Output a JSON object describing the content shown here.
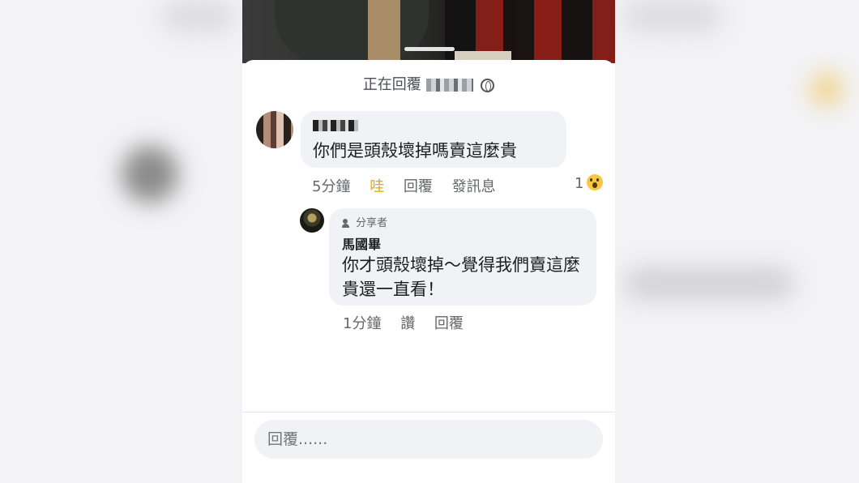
{
  "header": {
    "replying_to": "正在回覆"
  },
  "comment": {
    "text": "你們是頭殼壞掉嗎賣這麼貴",
    "time": "5分鐘",
    "reaction_label": "哇",
    "reply_label": "回覆",
    "message_label": "發訊息",
    "reaction_count": "1",
    "reaction_icon": "wow-emoji"
  },
  "reply": {
    "badge": "分享者",
    "author": "馬國畢",
    "text": "你才頭殼壞掉～覺得我們賣這麼貴還一直看！",
    "time": "1分鐘",
    "like_label": "讚",
    "reply_label": "回覆"
  },
  "composer": {
    "placeholder": "回覆......"
  },
  "colors": {
    "wow_active": "#e3a417",
    "bubble": "#f0f2f5",
    "meta": "#65676b"
  }
}
